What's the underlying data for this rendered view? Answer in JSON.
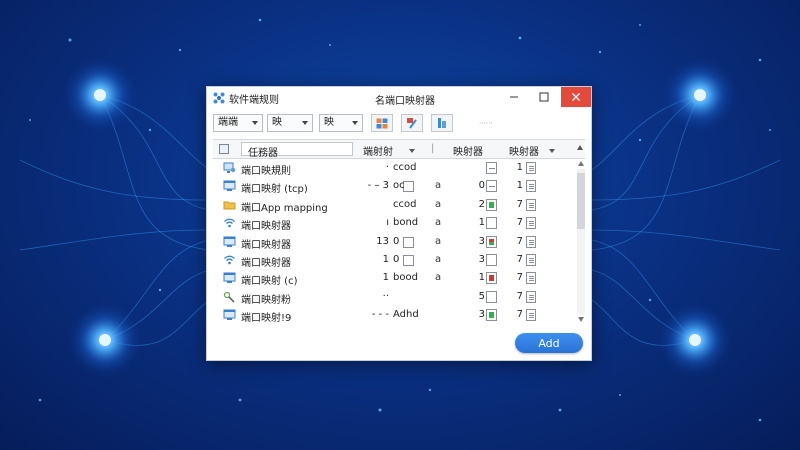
{
  "window": {
    "app_title": "软件端规则",
    "title": "名端口映射器"
  },
  "toolbar": {
    "dropdown1": "端端",
    "dropdown2": "映",
    "dropdown3": "映",
    "faint_label": "⋯⋯"
  },
  "table": {
    "columns": {
      "name_filter": "任務器",
      "port": "端射射",
      "status": "映射器"
    },
    "rows": [
      {
        "name": "端口映規則",
        "port": "·",
        "protocol": "ccod",
        "small": "",
        "num": "",
        "count": "1",
        "icon": "monitor-user",
        "box": "line",
        "port_box": false
      },
      {
        "name": "端口映射 (tcp)",
        "port": "- – 3",
        "protocol": "oc",
        "small": "a",
        "num": "0",
        "count": "1",
        "icon": "monitor",
        "box": "line",
        "port_box": true
      },
      {
        "name": "端口App mapping",
        "port": "",
        "protocol": "ccod",
        "small": "a",
        "num": "2",
        "count": "7",
        "icon": "folder",
        "box": "green",
        "port_box": false
      },
      {
        "name": "端口映射器",
        "port": "ı",
        "protocol": "bond",
        "small": "a",
        "num": "1",
        "count": "7",
        "icon": "wifi",
        "box": "empty",
        "port_box": false
      },
      {
        "name": "端口映射器",
        "port": "13",
        "protocol": "0",
        "small": "a",
        "num": "3",
        "count": "7",
        "icon": "monitor",
        "box": "red-green",
        "port_box": true
      },
      {
        "name": "端口映射器",
        "port": "1",
        "protocol": "0",
        "small": "a",
        "num": "3",
        "count": "7",
        "icon": "wifi",
        "box": "empty",
        "port_box": true
      },
      {
        "name": "端口映射 (c)",
        "port": "1",
        "protocol": "bood",
        "small": "a",
        "num": "1",
        "count": "7",
        "icon": "monitor",
        "box": "red",
        "port_box": false
      },
      {
        "name": "端口映射粉",
        "port": "··",
        "protocol": "",
        "small": "",
        "num": "5",
        "count": "7",
        "icon": "tool",
        "box": "empty",
        "port_box": false
      },
      {
        "name": "端口映射!9",
        "port": "- - -",
        "protocol": "Adhd",
        "small": "",
        "num": "3",
        "count": "7",
        "icon": "monitor",
        "box": "green",
        "port_box": false
      }
    ]
  },
  "buttons": {
    "add": "Add"
  },
  "colors": {
    "accent": "#2a7de1",
    "close": "#e24a3b",
    "status_green": "#2fb44a",
    "status_red": "#d9352b"
  }
}
